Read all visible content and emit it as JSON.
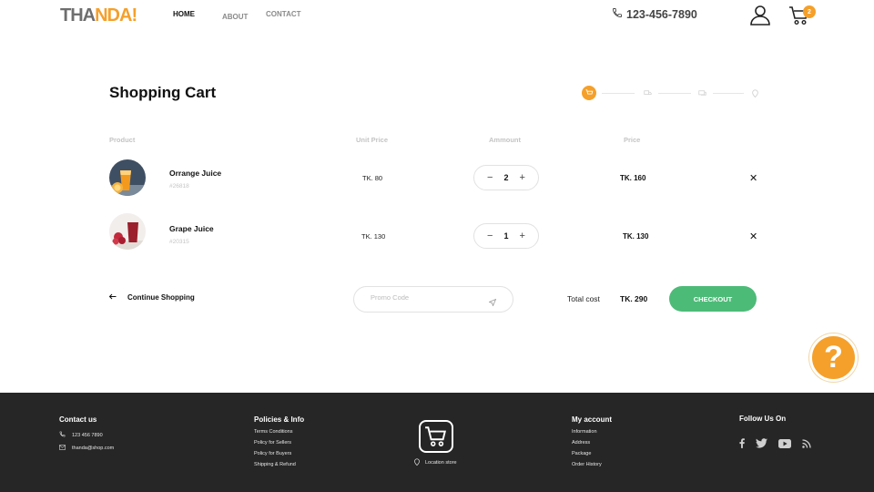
{
  "header": {
    "logo_part1": "THA",
    "logo_part2": "NDA!",
    "nav": {
      "home": "HOME",
      "about": "ABOUT",
      "contact": "CONTACT"
    },
    "phone": "123-456-7890",
    "cart_count": "2"
  },
  "cart": {
    "title": "Shopping Cart",
    "columns": {
      "product": "Product",
      "unit_price": "Unit Price",
      "amount": "Ammount",
      "price": "Price"
    },
    "items": [
      {
        "name": "Orrange Juice",
        "sku": "#26818",
        "unit_price": "TK. 80",
        "qty": "2",
        "price": "TK. 160"
      },
      {
        "name": "Grape Juice",
        "sku": "#20315",
        "unit_price": "TK. 130",
        "qty": "1",
        "price": "TK. 130"
      }
    ],
    "continue_label": "Continue Shopping",
    "promo_placeholder": "Promo Code",
    "total_label": "Total cost",
    "total_value": "TK. 290",
    "checkout_label": "CHECKOUT"
  },
  "help": {
    "label": "?"
  },
  "footer": {
    "contact": {
      "heading": "Contact us",
      "phone": "123 456 7890",
      "email": "thanda@shop.com"
    },
    "policies": {
      "heading": "Policies & Info",
      "links": [
        "Terms Conditions",
        "Policy for Sellers",
        "Policy for Buyers",
        "Shipping & Refund"
      ]
    },
    "location_label": "Location store",
    "account": {
      "heading": "My account",
      "links": [
        "Information",
        "Address",
        "Package",
        "Order History"
      ]
    },
    "follow": {
      "heading": "Follow Us On"
    }
  },
  "colors": {
    "accent": "#f5a02a",
    "checkout": "#4dbb78",
    "footer_bg": "#262626"
  }
}
